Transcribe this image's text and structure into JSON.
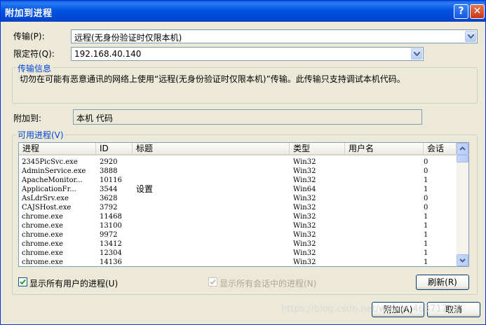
{
  "window": {
    "title": "附加到进程",
    "help_label": "?",
    "close_label": "✕"
  },
  "transport": {
    "label": "传输(P):",
    "value": "远程(无身份验证时仅限本机)"
  },
  "qualifier": {
    "label": "限定符(Q):",
    "value": "192.168.40.140"
  },
  "transport_info": {
    "title": "传输信息",
    "text": "切勿在可能有恶意通讯的网络上使用“远程(无身份验证时仅限本机)”传输。此传输只支持调试本机代码。"
  },
  "attach_to": {
    "label": "附加到:",
    "value": "本机 代码"
  },
  "available": {
    "title": "可用进程(V)",
    "columns": [
      "进程",
      "ID",
      "标题",
      "类型",
      "用户名",
      "会话"
    ],
    "rows": [
      {
        "process": "2345PicSvc.exe",
        "id": "2920",
        "title": "",
        "type": "Win32",
        "user": "",
        "session": "0"
      },
      {
        "process": "AdminService.exe",
        "id": "3888",
        "title": "",
        "type": "Win32",
        "user": "",
        "session": "0"
      },
      {
        "process": "ApacheMonitor...",
        "id": "10116",
        "title": "",
        "type": "Win32",
        "user": "",
        "session": "1"
      },
      {
        "process": "ApplicationFr...",
        "id": "3544",
        "title": "设置",
        "type": "Win64",
        "user": "",
        "session": "1"
      },
      {
        "process": "AsLdrSrv.exe",
        "id": "3628",
        "title": "",
        "type": "Win32",
        "user": "",
        "session": "0"
      },
      {
        "process": "CAJSHost.exe",
        "id": "3792",
        "title": "",
        "type": "Win32",
        "user": "",
        "session": "0"
      },
      {
        "process": "chrome.exe",
        "id": "11468",
        "title": "",
        "type": "Win32",
        "user": "",
        "session": "1"
      },
      {
        "process": "chrome.exe",
        "id": "13100",
        "title": "",
        "type": "Win32",
        "user": "",
        "session": "1"
      },
      {
        "process": "chrome.exe",
        "id": "9972",
        "title": "",
        "type": "Win32",
        "user": "",
        "session": "1"
      },
      {
        "process": "chrome.exe",
        "id": "13412",
        "title": "",
        "type": "Win32",
        "user": "",
        "session": "1"
      },
      {
        "process": "chrome.exe",
        "id": "12304",
        "title": "",
        "type": "Win32",
        "user": "",
        "session": "1"
      },
      {
        "process": "chrome.exe",
        "id": "14136",
        "title": "",
        "type": "Win32",
        "user": "",
        "session": "1"
      }
    ]
  },
  "options": {
    "show_all_users": "显示所有用户的进程(U)",
    "show_all_sessions": "显示所有会话中的进程(N)",
    "refresh": "刷新(R)"
  },
  "buttons": {
    "attach": "附加(A)",
    "cancel": "取消"
  },
  "watermark": "https://blog.csdn.net/weixin_46371723"
}
